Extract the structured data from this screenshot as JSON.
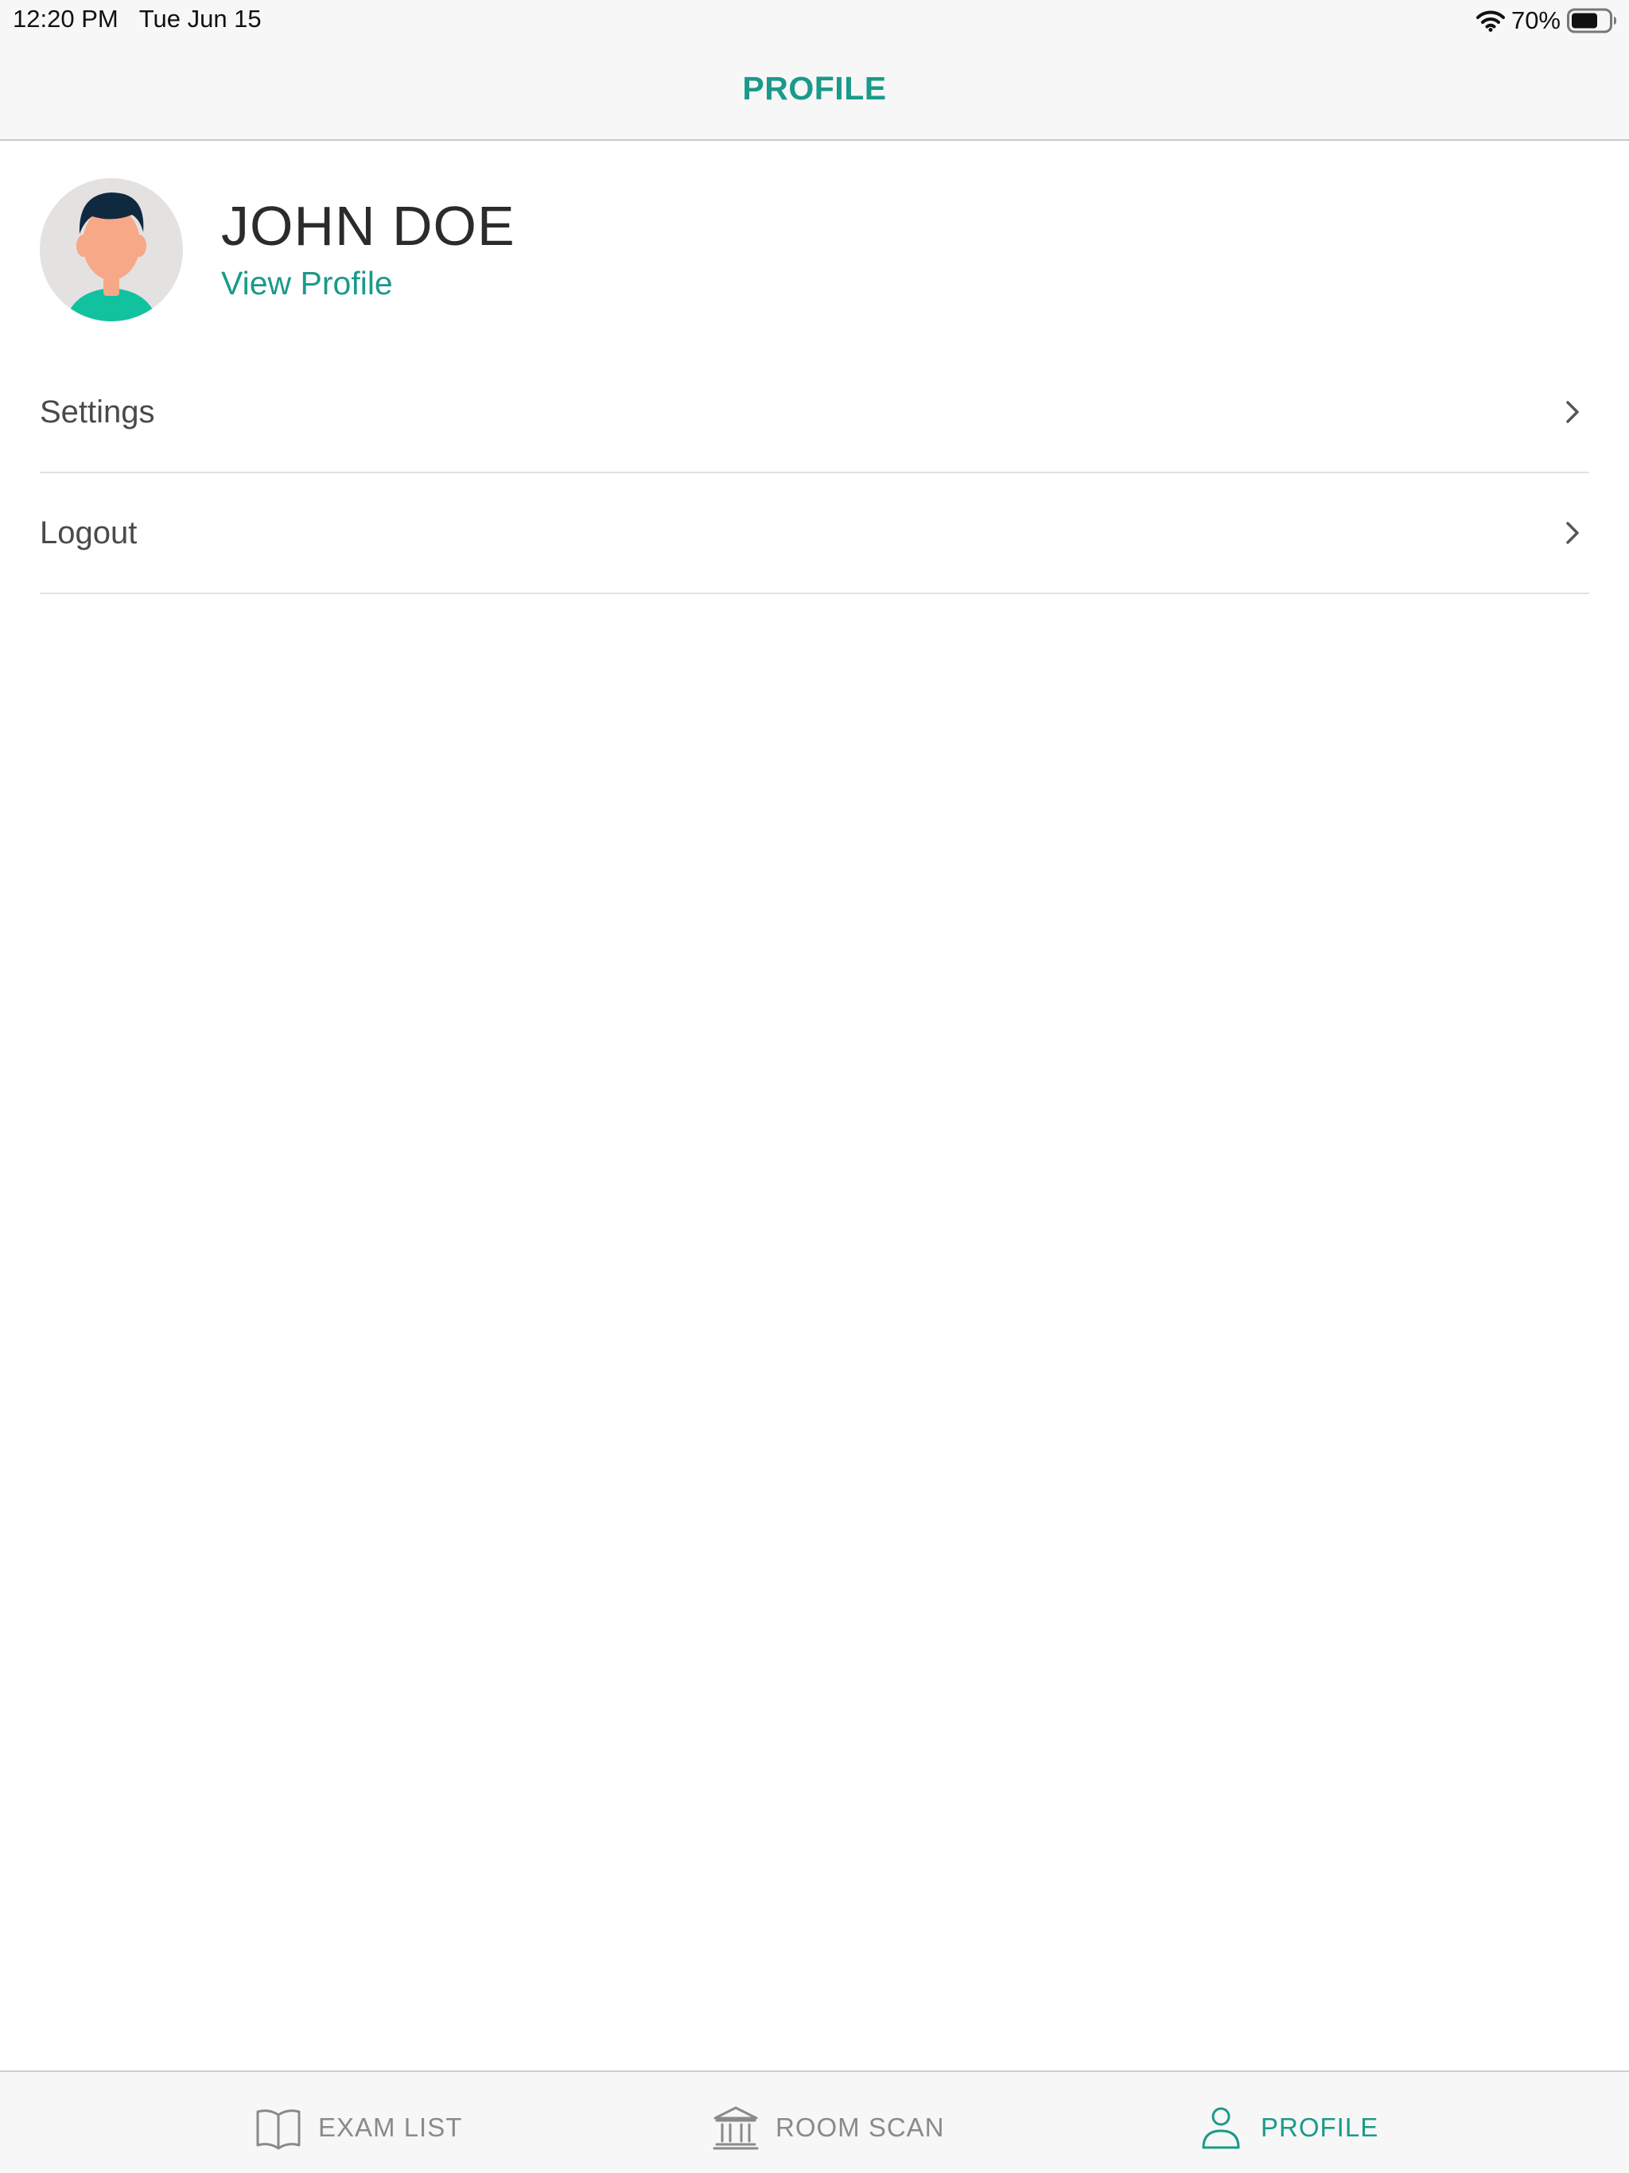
{
  "status_bar": {
    "time": "12:20 PM",
    "date": "Tue Jun 15",
    "battery_percent": "70%",
    "battery_level": 0.7,
    "icons": [
      "wifi-icon",
      "battery-icon"
    ]
  },
  "nav": {
    "title": "PROFILE"
  },
  "profile": {
    "name": "JOHN DOE",
    "view_profile_label": "View Profile",
    "avatar_icon": "avatar-illustration"
  },
  "menu": {
    "items": [
      {
        "label": "Settings",
        "icon": "chevron-right-icon"
      },
      {
        "label": "Logout",
        "icon": "chevron-right-icon"
      }
    ]
  },
  "tabs": [
    {
      "label": "EXAM LIST",
      "icon": "book-icon",
      "active": false
    },
    {
      "label": "ROOM SCAN",
      "icon": "institution-icon",
      "active": false
    },
    {
      "label": "PROFILE",
      "icon": "person-icon",
      "active": true
    }
  ],
  "colors": {
    "accent": "#1a9a8a",
    "inactive_tab": "#8a8a8a",
    "shirt": "#12c29f",
    "hair": "#0f2a3f",
    "skin": "#f7a886"
  }
}
